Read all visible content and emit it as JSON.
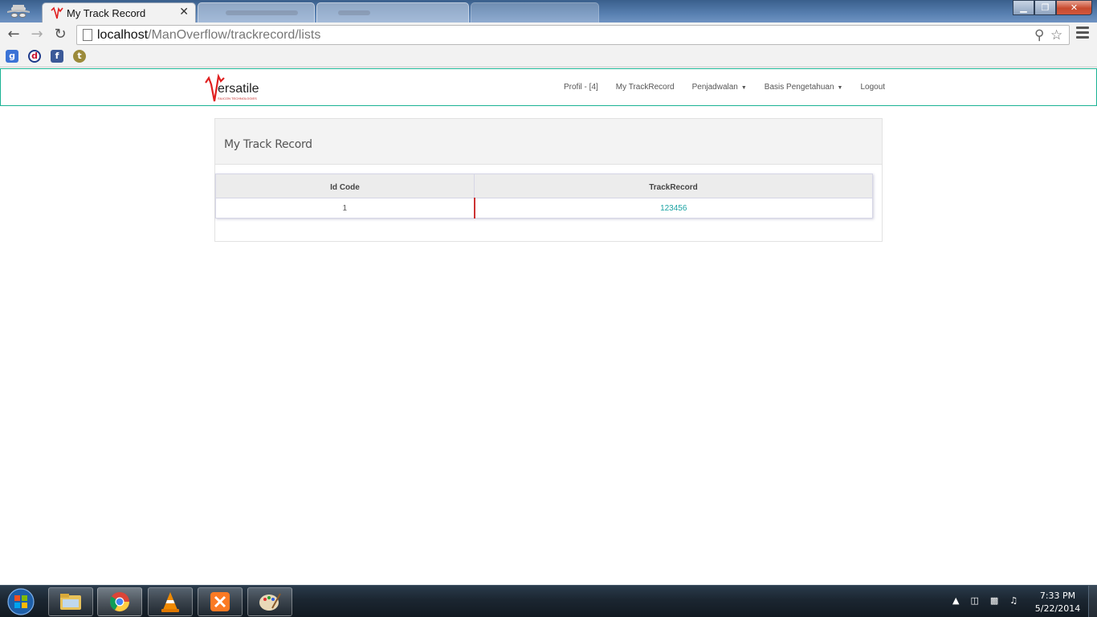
{
  "browser": {
    "active_tab": {
      "title": "My Track Record",
      "close": "✕"
    },
    "url": {
      "host": "localhost",
      "path": "/ManOverflow/trackrecord/lists"
    },
    "bookmarks": [
      {
        "icon": "google-icon",
        "glyph": "g",
        "color": "#3b73d6"
      },
      {
        "icon": "d-icon",
        "glyph": "d",
        "color": "#c8102e"
      },
      {
        "icon": "facebook-icon",
        "glyph": "f",
        "color": "#3b5998"
      },
      {
        "icon": "t-badge-icon",
        "glyph": "t",
        "color": "#9b8a3a"
      }
    ]
  },
  "navbar": {
    "logo_text": "ersatile",
    "logo_sub": "SILICON TECHNOLOGIES",
    "links": [
      "Profil - [4]",
      "My TrackRecord",
      "Penjadwalan",
      "Basis Pengetahuan",
      "Logout"
    ]
  },
  "page": {
    "title": "My Track Record",
    "table": {
      "headers": [
        "Id Code",
        "TrackRecord"
      ],
      "rows": [
        {
          "id": "1",
          "track": "123456"
        }
      ]
    }
  },
  "taskbar": {
    "time": "7:33 PM",
    "date": "5/22/2014"
  },
  "colors": {
    "accent": "#1ab394",
    "link": "#1aa3a3",
    "logo_red": "#e02020"
  }
}
